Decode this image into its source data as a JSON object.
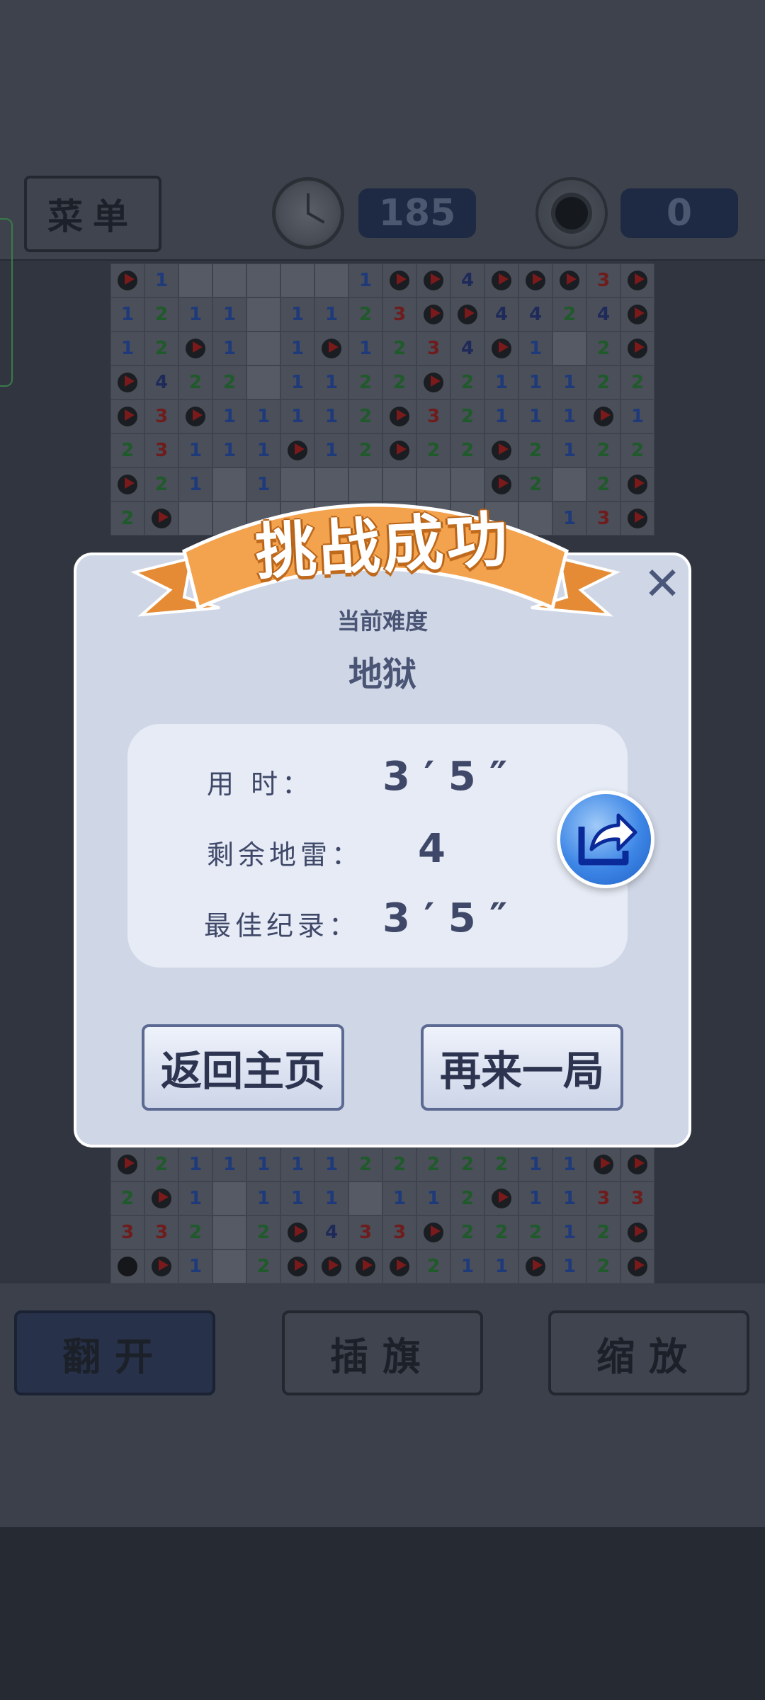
{
  "header": {
    "menu_label": "菜单",
    "timer": "185",
    "mines_left": "0"
  },
  "board_top": [
    [
      "f",
      "1",
      "e",
      "e",
      "e",
      "e",
      "e",
      "1",
      "f",
      "f",
      "4",
      "f",
      "f",
      "f",
      "3",
      "f"
    ],
    [
      "1",
      "2",
      "1",
      "1",
      "e",
      "1",
      "1",
      "2",
      "3",
      "f",
      "f",
      "4",
      "4",
      "2",
      "4",
      "f"
    ],
    [
      "1",
      "2",
      "f",
      "1",
      "e",
      "1",
      "f",
      "1",
      "2",
      "3",
      "4",
      "f",
      "1",
      "e",
      "2",
      "f"
    ],
    [
      "f",
      "4",
      "2",
      "2",
      "e",
      "1",
      "1",
      "2",
      "2",
      "f",
      "2",
      "1",
      "1",
      "1",
      "2",
      "2"
    ],
    [
      "f",
      "3",
      "f",
      "1",
      "1",
      "1",
      "1",
      "2",
      "f",
      "3",
      "2",
      "1",
      "1",
      "1",
      "f",
      "1"
    ],
    [
      "2",
      "3",
      "1",
      "1",
      "1",
      "f",
      "1",
      "2",
      "f",
      "2",
      "2",
      "f",
      "2",
      "1",
      "2",
      "2"
    ],
    [
      "f",
      "2",
      "1",
      "e",
      "1",
      "e",
      "e",
      "e",
      "e",
      "e",
      "e",
      "f",
      "2",
      "e",
      "2",
      "f"
    ],
    [
      "2",
      "f",
      "e",
      "e",
      "e",
      "e",
      "e",
      "e",
      "e",
      "e",
      "e",
      "e",
      "e",
      "1",
      "3",
      "f"
    ]
  ],
  "board_bottom": [
    [
      "f",
      "2",
      "1",
      "1",
      "1",
      "1",
      "1",
      "2",
      "2",
      "2",
      "2",
      "2",
      "1",
      "1",
      "f",
      "f"
    ],
    [
      "2",
      "f",
      "1",
      "e",
      "1",
      "1",
      "1",
      "e",
      "1",
      "1",
      "2",
      "f",
      "1",
      "1",
      "3",
      "3"
    ],
    [
      "3",
      "3",
      "2",
      "e",
      "2",
      "f",
      "4",
      "3",
      "3",
      "f",
      "2",
      "2",
      "2",
      "1",
      "2",
      "f"
    ],
    [
      "m",
      "f",
      "1",
      "e",
      "2",
      "f",
      "f",
      "f",
      "f",
      "2",
      "1",
      "1",
      "f",
      "1",
      "2",
      "f"
    ]
  ],
  "dialog": {
    "banner_title": "挑战成功",
    "difficulty_label": "当前难度",
    "difficulty_value": "地狱",
    "time_label": "用      时",
    "time_value": "3 ′ 5 ″",
    "mines_label": "剩余地雷",
    "mines_value": "4",
    "best_label": "最佳纪录",
    "best_value": "3 ′ 5 ″",
    "colon": "：",
    "home_button": "返回主页",
    "again_button": "再来一局",
    "close_glyph": "✕"
  },
  "bottom_bar": {
    "open_label": "翻开",
    "flag_label": "插旗",
    "zoom_label": "缩放"
  },
  "icons": {
    "clock": "clock-icon",
    "mine": "mine-icon",
    "share": "share-icon",
    "close": "close-icon"
  },
  "colors": {
    "dialog_bg": "#cfd6e6",
    "banner_orange": "#f3a24e",
    "share_blue": "#3d86e6",
    "text_dark": "#3f4868"
  }
}
